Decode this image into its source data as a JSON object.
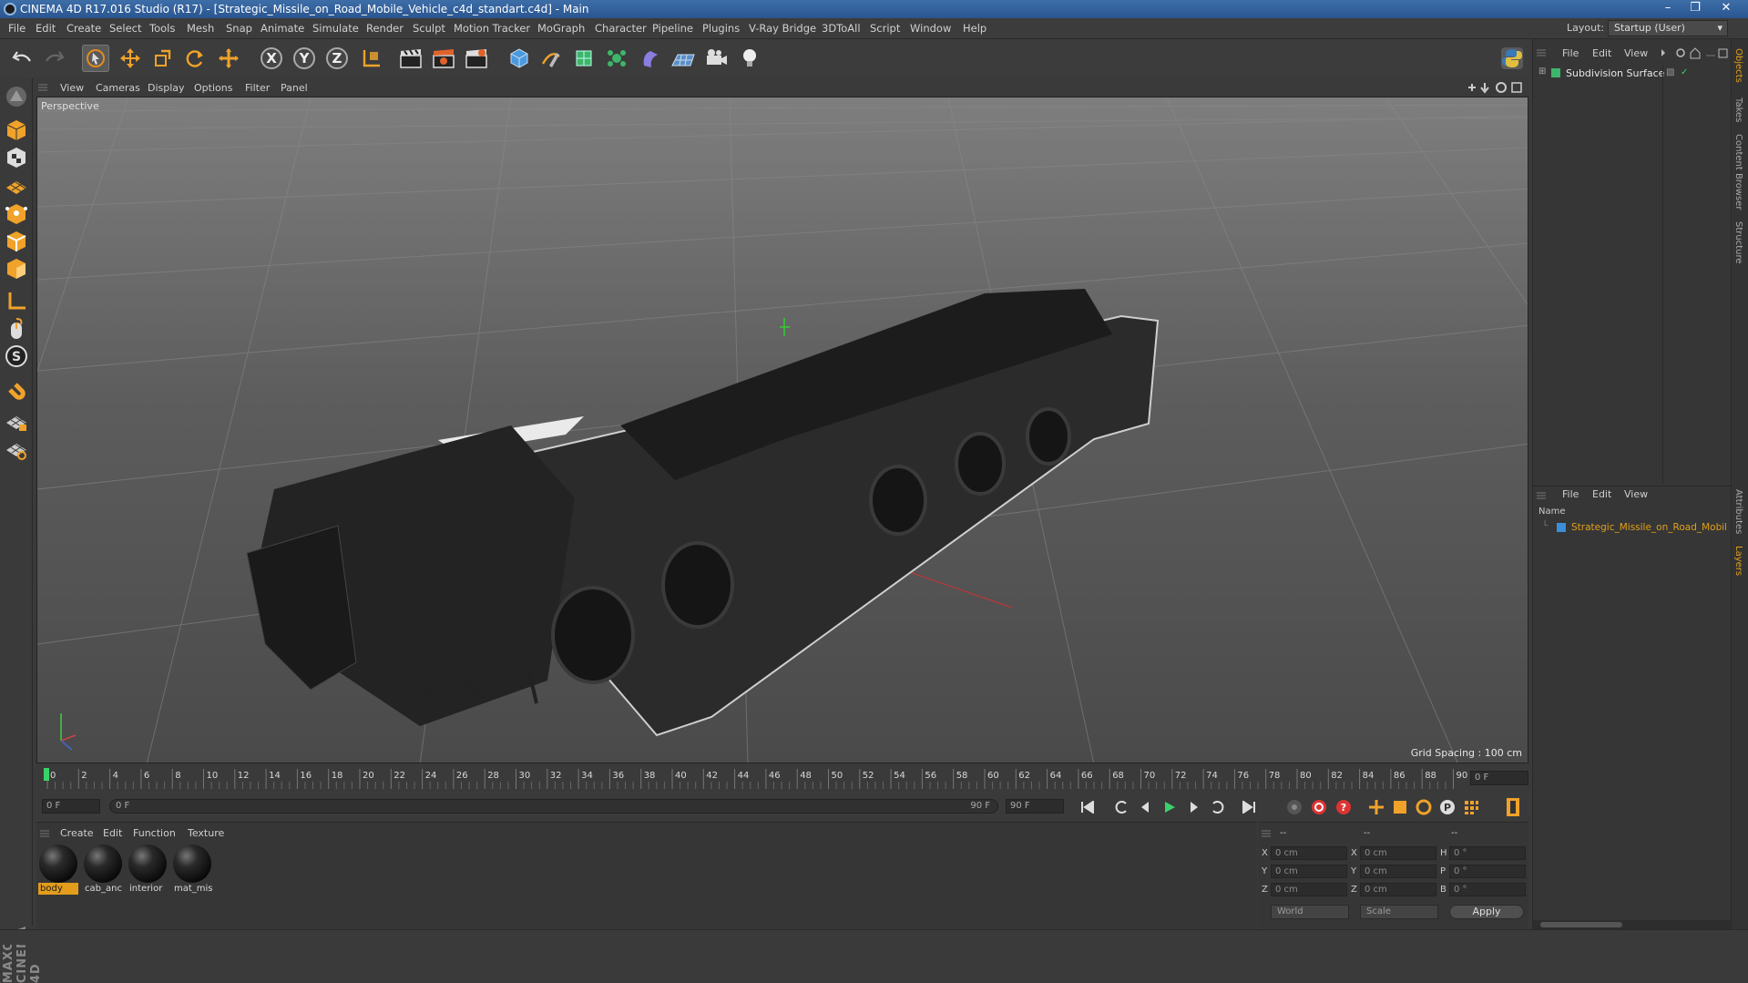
{
  "window": {
    "title": "CINEMA 4D R17.016 Studio (R17) - [Strategic_Missile_on_Road_Mobile_Vehicle_c4d_standart.c4d] - Main",
    "minimize": "–",
    "maximize": "❐",
    "close": "✕"
  },
  "menubar": {
    "items": [
      "File",
      "Edit",
      "Create",
      "Select",
      "Tools",
      "Mesh",
      "Snap",
      "Animate",
      "Simulate",
      "Render",
      "Sculpt",
      "Motion Tracker",
      "MoGraph",
      "Character",
      "Pipeline",
      "Plugins",
      "V-Ray Bridge",
      "3DToAll",
      "Script",
      "Window",
      "Help"
    ],
    "layout_label": "Layout:",
    "layout_value": "Startup (User)"
  },
  "viewport": {
    "menu": [
      "View",
      "Cameras",
      "Display",
      "Options",
      "Filter",
      "Panel"
    ],
    "label": "Perspective",
    "grid_spacing": "Grid Spacing : 100 cm"
  },
  "timeline": {
    "ticks": [
      "0",
      "2",
      "4",
      "6",
      "8",
      "10",
      "12",
      "14",
      "16",
      "18",
      "20",
      "22",
      "24",
      "26",
      "28",
      "30",
      "32",
      "34",
      "36",
      "38",
      "40",
      "42",
      "44",
      "46",
      "48",
      "50",
      "52",
      "54",
      "56",
      "58",
      "60",
      "62",
      "64",
      "66",
      "68",
      "70",
      "72",
      "74",
      "76",
      "78",
      "80",
      "82",
      "84",
      "86",
      "88",
      "90"
    ],
    "current_frame": "0 F",
    "start_field": "0 F",
    "range_start": "0 F",
    "range_end": "90 F",
    "end_field": "90 F"
  },
  "materials": {
    "menu": [
      "Create",
      "Edit",
      "Function",
      "Texture"
    ],
    "items": [
      "body",
      "cab_anc",
      "interior",
      "mat_mis"
    ]
  },
  "coordinates": {
    "headers": [
      "--",
      "--",
      "--"
    ],
    "rows": [
      {
        "a": "X",
        "av": "0 cm",
        "b": "X",
        "bv": "0 cm",
        "c": "H",
        "cv": "0 °"
      },
      {
        "a": "Y",
        "av": "0 cm",
        "b": "Y",
        "bv": "0 cm",
        "c": "P",
        "cv": "0 °"
      },
      {
        "a": "Z",
        "av": "0 cm",
        "b": "Z",
        "bv": "0 cm",
        "c": "B",
        "cv": "0 °"
      }
    ],
    "mode_world": "World",
    "mode_scale": "Scale",
    "apply": "Apply"
  },
  "objects": {
    "menu": [
      "File",
      "Edit",
      "View"
    ],
    "items": [
      "Subdivision Surface"
    ]
  },
  "layers": {
    "menu": [
      "File",
      "Edit",
      "View"
    ],
    "column": "Name",
    "items": [
      "Strategic_Missile_on_Road_Mobile_Vehicle"
    ]
  },
  "right_tabs": [
    "Objects",
    "Takes",
    "Content Browser",
    "Structure",
    "Attributes",
    "Layers"
  ],
  "brand": "MAXON CINEMA 4D",
  "colors": {
    "accent": "#e29d1c",
    "title_bar": "#2a5590"
  }
}
